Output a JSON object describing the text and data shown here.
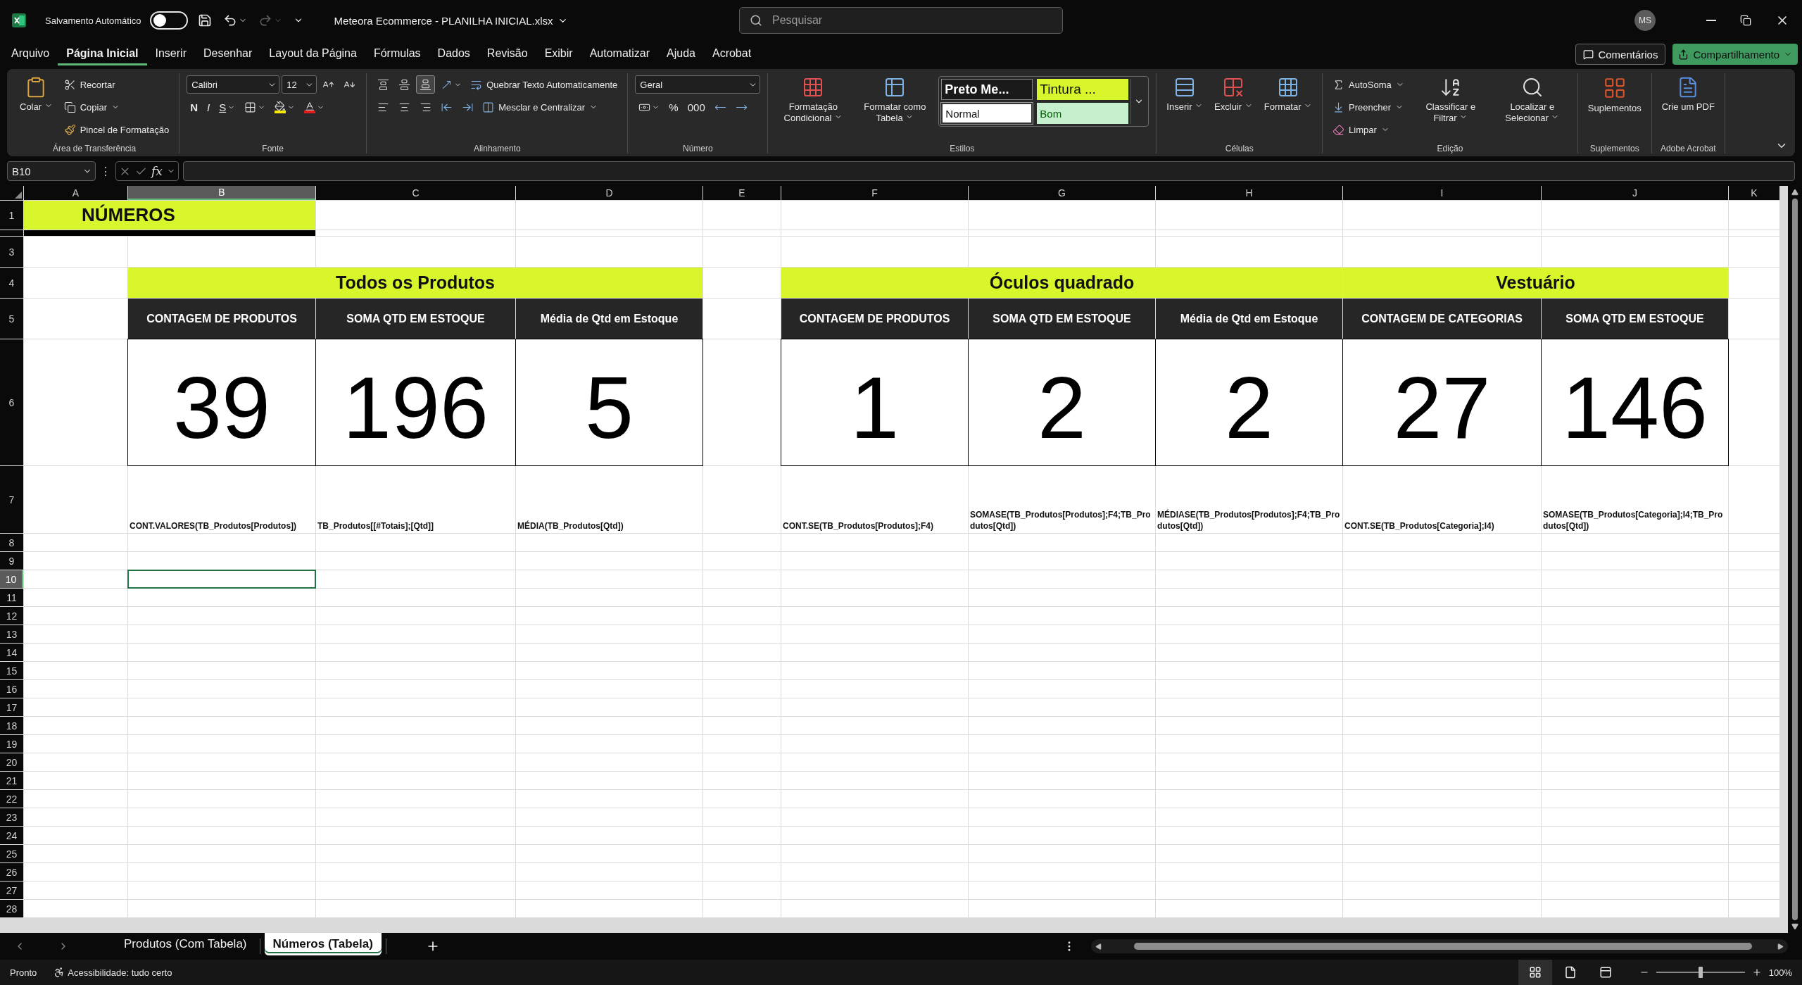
{
  "title_bar": {
    "autosave_label": "Salvamento Automático",
    "autosave_on": false,
    "redo_disabled": true,
    "document_title": "Meteora Ecommerce - PLANILHA INICIAL.xlsx",
    "search": {
      "placeholder": "Pesquisar"
    },
    "account_initials": "MS"
  },
  "menu_tabs": [
    {
      "label": "Arquivo",
      "selected": false
    },
    {
      "label": "Página Inicial",
      "selected": true
    },
    {
      "label": "Inserir",
      "selected": false
    },
    {
      "label": "Desenhar",
      "selected": false
    },
    {
      "label": "Layout da Página",
      "selected": false
    },
    {
      "label": "Fórmulas",
      "selected": false
    },
    {
      "label": "Dados",
      "selected": false
    },
    {
      "label": "Revisão",
      "selected": false
    },
    {
      "label": "Exibir",
      "selected": false
    },
    {
      "label": "Automatizar",
      "selected": false
    },
    {
      "label": "Ajuda",
      "selected": false
    },
    {
      "label": "Acrobat",
      "selected": false
    }
  ],
  "menu_buttons": {
    "comments": "Comentários",
    "share": "Compartilhamento"
  },
  "ribbon": {
    "groups": [
      {
        "title": "Área de Transferência",
        "columns": [
          {
            "kind": "large",
            "label": "Colar",
            "menu": true
          },
          {
            "kind": "stack",
            "rows": [
              {
                "items": [
                  {
                    "kind": "small",
                    "label": "Recortar"
                  }
                ]
              },
              {
                "items": [
                  {
                    "kind": "small",
                    "label": "Copiar",
                    "menu": true
                  }
                ]
              },
              {
                "items": [
                  {
                    "kind": "small",
                    "label": "Pincel de Formatação"
                  }
                ]
              }
            ]
          }
        ]
      },
      {
        "title": "Fonte",
        "columns": [
          {
            "kind": "stack",
            "rows": [
              {
                "items": [
                  {
                    "kind": "combo",
                    "value": "Calibri"
                  },
                  {
                    "kind": "combo",
                    "value": "12"
                  },
                  {
                    "kind": "tool"
                  },
                  {
                    "kind": "tool"
                  }
                ]
              },
              {
                "items": [
                  {
                    "kind": "bold",
                    "label": "N"
                  },
                  {
                    "kind": "italic",
                    "label": "I"
                  },
                  {
                    "kind": "underline",
                    "label": "S",
                    "menu": true
                  },
                  {
                    "kind": "tool",
                    "menu": true
                  },
                  {
                    "kind": "tool",
                    "menu": true
                  },
                  {
                    "kind": "tool",
                    "menu": true
                  }
                ]
              }
            ]
          }
        ]
      },
      {
        "title": "Alinhamento",
        "columns": [
          {
            "kind": "stack",
            "rows": [
              {
                "items": [
                  {
                    "kind": "tool",
                    "selected": false
                  },
                  {
                    "kind": "tool",
                    "selected": false
                  },
                  {
                    "kind": "tool",
                    "selected": true
                  },
                  {
                    "kind": "tool",
                    "menu": true
                  },
                  {
                    "kind": "small",
                    "label": "Quebrar Texto Automaticamente"
                  }
                ]
              },
              {
                "items": [
                  {
                    "kind": "tool",
                    "selected": false
                  },
                  {
                    "kind": "tool",
                    "selected": false
                  },
                  {
                    "kind": "tool",
                    "selected": false
                  },
                  {
                    "kind": "tool"
                  },
                  {
                    "kind": "tool"
                  },
                  {
                    "kind": "small",
                    "label": "Mesclar e Centralizar",
                    "menu": true
                  }
                ]
              }
            ]
          }
        ]
      },
      {
        "title": "Número",
        "columns": [
          {
            "kind": "stack",
            "rows": [
              {
                "items": [
                  {
                    "kind": "combo",
                    "value": "Geral"
                  }
                ]
              },
              {
                "items": [
                  {
                    "kind": "tool",
                    "menu": true
                  },
                  {
                    "kind": "char",
                    "label": "%"
                  },
                  {
                    "kind": "char",
                    "label": "000"
                  },
                  {
                    "kind": "tool"
                  },
                  {
                    "kind": "tool"
                  }
                ]
              }
            ]
          }
        ]
      },
      {
        "title": "Estilos",
        "columns": [
          {
            "kind": "large",
            "label": "Formatação Condicional",
            "menu": true
          },
          {
            "kind": "large",
            "label": "Formatar como Tabela",
            "menu": true
          },
          {
            "kind": "gallery",
            "rows": [
              {
                "items": [
                  {
                    "kind": "style-dark",
                    "label": "Preto Me..."
                  },
                  {
                    "kind": "style-lime",
                    "label": "Tintura ..."
                  }
                ]
              },
              {
                "items": [
                  {
                    "kind": "style-white",
                    "label": "Normal"
                  },
                  {
                    "kind": "style-good",
                    "label": "Bom"
                  }
                ]
              }
            ]
          }
        ]
      },
      {
        "title": "Células",
        "columns": [
          {
            "kind": "large",
            "label": "Inserir",
            "menu": true
          },
          {
            "kind": "large",
            "label": "Excluir",
            "menu": true
          },
          {
            "kind": "large",
            "label": "Formatar",
            "menu": true
          }
        ]
      },
      {
        "title": "Edição",
        "columns": [
          {
            "kind": "stack",
            "rows": [
              {
                "items": [
                  {
                    "kind": "small",
                    "label": "AutoSoma",
                    "menu": true
                  }
                ]
              },
              {
                "items": [
                  {
                    "kind": "small",
                    "label": "Preencher",
                    "menu": true
                  }
                ]
              },
              {
                "items": [
                  {
                    "kind": "small",
                    "label": "Limpar",
                    "menu": true
                  }
                ]
              }
            ]
          },
          {
            "kind": "large",
            "label": "Classificar e Filtrar",
            "menu": true
          },
          {
            "kind": "large",
            "label": "Localizar e Selecionar",
            "menu": true
          }
        ]
      },
      {
        "title": "Suplementos",
        "columns": [
          {
            "kind": "large",
            "label": "Suplementos",
            "menu": false
          }
        ]
      },
      {
        "title": "Adobe Acrobat",
        "columns": [
          {
            "kind": "large",
            "label": "Crie um PDF",
            "menu": false
          }
        ]
      }
    ]
  },
  "formula_bar": {
    "name_box": "B10",
    "more_glyph": "⋮",
    "function_label": "fx"
  },
  "sheet": {
    "columns": [
      {
        "label": "A",
        "selected": false
      },
      {
        "label": "B",
        "selected": true
      },
      {
        "label": "C",
        "selected": false
      },
      {
        "label": "D",
        "selected": false
      },
      {
        "label": "E",
        "selected": false
      },
      {
        "label": "F",
        "selected": false
      },
      {
        "label": "G",
        "selected": false
      },
      {
        "label": "H",
        "selected": false
      },
      {
        "label": "I",
        "selected": false
      },
      {
        "label": "J",
        "selected": false
      },
      {
        "label": "K",
        "selected": false
      }
    ],
    "rows": [
      {
        "label": "1",
        "selected": false
      },
      {
        "label": "3",
        "selected": false
      },
      {
        "label": "4",
        "selected": false
      },
      {
        "label": "5",
        "selected": false
      },
      {
        "label": "6",
        "selected": false
      },
      {
        "label": "7",
        "selected": false
      },
      {
        "label": "8",
        "selected": false
      },
      {
        "label": "9",
        "selected": false
      },
      {
        "label": "10",
        "selected": true
      },
      {
        "label": "11",
        "selected": false
      },
      {
        "label": "12",
        "selected": false
      },
      {
        "label": "13",
        "selected": false
      },
      {
        "label": "14",
        "selected": false
      },
      {
        "label": "15",
        "selected": false
      },
      {
        "label": "16",
        "selected": false
      },
      {
        "label": "17",
        "selected": false
      },
      {
        "label": "18",
        "selected": false
      },
      {
        "label": "19",
        "selected": false
      },
      {
        "label": "20",
        "selected": false
      },
      {
        "label": "21",
        "selected": false
      },
      {
        "label": "22",
        "selected": false
      },
      {
        "label": "23",
        "selected": false
      },
      {
        "label": "24",
        "selected": false
      },
      {
        "label": "25",
        "selected": false
      },
      {
        "label": "26",
        "selected": false
      },
      {
        "label": "27",
        "selected": false
      },
      {
        "label": "28",
        "selected": false
      }
    ],
    "title": "NÚMEROS",
    "groups": [
      {
        "title": "Todos os Produtos",
        "columns": [
          {
            "header": "CONTAGEM DE PRODUTOS",
            "value": "39",
            "formula": "CONT.VALORES(TB_Produtos[Produtos])"
          },
          {
            "header": "SOMA QTD EM ESTOQUE",
            "value": "196",
            "formula": "TB_Produtos[[#Totais];[Qtd]]"
          },
          {
            "header": "Média de Qtd em Estoque",
            "value": "5",
            "formula": "MÉDIA(TB_Produtos[Qtd])"
          }
        ]
      },
      {
        "title": "Óculos quadrado",
        "columns": [
          {
            "header": "CONTAGEM DE PRODUTOS",
            "value": "1",
            "formula": "CONT.SE(TB_Produtos[Produtos];F4)"
          },
          {
            "header": "SOMA QTD EM ESTOQUE",
            "value": "2",
            "formula": "SOMASE(TB_Produtos[Produtos];F4;TB_Produtos[Qtd])"
          },
          {
            "header": "Média de Qtd em Estoque",
            "value": "2",
            "formula": "MÉDIASE(TB_Produtos[Produtos];F4;TB_Produtos[Qtd])"
          }
        ]
      },
      {
        "title": "Vestuário",
        "columns": [
          {
            "header": "CONTAGEM DE CATEGORIAS",
            "value": "27",
            "formula": "CONT.SE(TB_Produtos[Categoria];I4)"
          },
          {
            "header": "SOMA QTD EM ESTOQUE",
            "value": "146",
            "formula": "SOMASE(TB_Produtos[Categoria];I4;TB_Produtos[Qtd])"
          }
        ]
      }
    ]
  },
  "sheet_tabs": [
    {
      "label": "Produtos (Com Tabela)",
      "selected": false
    },
    {
      "label": "Números (Tabela)",
      "selected": true
    }
  ],
  "status_bar": {
    "status": "Pronto",
    "accessibility": "Acessibilidade: tudo certo",
    "views": [
      {
        "selected": true
      },
      {
        "selected": false
      },
      {
        "selected": false
      }
    ],
    "zoom": {
      "level": 0.5,
      "reading": "100%"
    }
  }
}
